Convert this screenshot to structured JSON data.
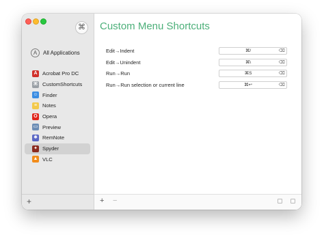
{
  "sidebar": {
    "header_icon": "⌘",
    "all_apps_label": "All Applications",
    "all_apps_icon": "A",
    "apps": [
      {
        "label": "Acrobat Pro DC",
        "icon": "acrobat-icon",
        "glyph": "A",
        "color": "#d0302b",
        "selected": false
      },
      {
        "label": "CustomShortcuts",
        "icon": "customshortcuts-icon",
        "glyph": "⌘",
        "color": "#9aa0a6",
        "selected": false
      },
      {
        "label": "Finder",
        "icon": "finder-icon",
        "glyph": "☺",
        "color": "#3b8de2",
        "selected": false
      },
      {
        "label": "Notes",
        "icon": "notes-icon",
        "glyph": "≡",
        "color": "#f3c94a",
        "selected": false
      },
      {
        "label": "Opera",
        "icon": "opera-icon",
        "glyph": "O",
        "color": "#e0251b",
        "selected": false
      },
      {
        "label": "Preview",
        "icon": "preview-icon",
        "glyph": "▭",
        "color": "#6c8db5",
        "selected": false
      },
      {
        "label": "RemNote",
        "icon": "remnote-icon",
        "glyph": "✱",
        "color": "#5966c4",
        "selected": false
      },
      {
        "label": "Spyder",
        "icon": "spyder-icon",
        "glyph": "✦",
        "color": "#8b2a1e",
        "selected": true
      },
      {
        "label": "VLC",
        "icon": "vlc-icon",
        "glyph": "▲",
        "color": "#f28c1b",
        "selected": false
      }
    ],
    "add_label": "+"
  },
  "main": {
    "title": "Custom Menu Shortcuts",
    "shortcuts": [
      {
        "label": "Edit→Indent",
        "keys": "⌘/",
        "clear": "⌫"
      },
      {
        "label": "Edit→Unindent",
        "keys": "⌘\\",
        "clear": "⌫"
      },
      {
        "label": "Run→Run",
        "keys": "⌘S",
        "clear": "⌫"
      },
      {
        "label": "Run→Run selection or current line",
        "keys": "⌘↩",
        "clear": "⌫"
      }
    ],
    "footer": {
      "add": "+",
      "remove": "−"
    }
  },
  "colors": {
    "accent": "#4caf79",
    "selected_row": "#d2d2d2"
  }
}
